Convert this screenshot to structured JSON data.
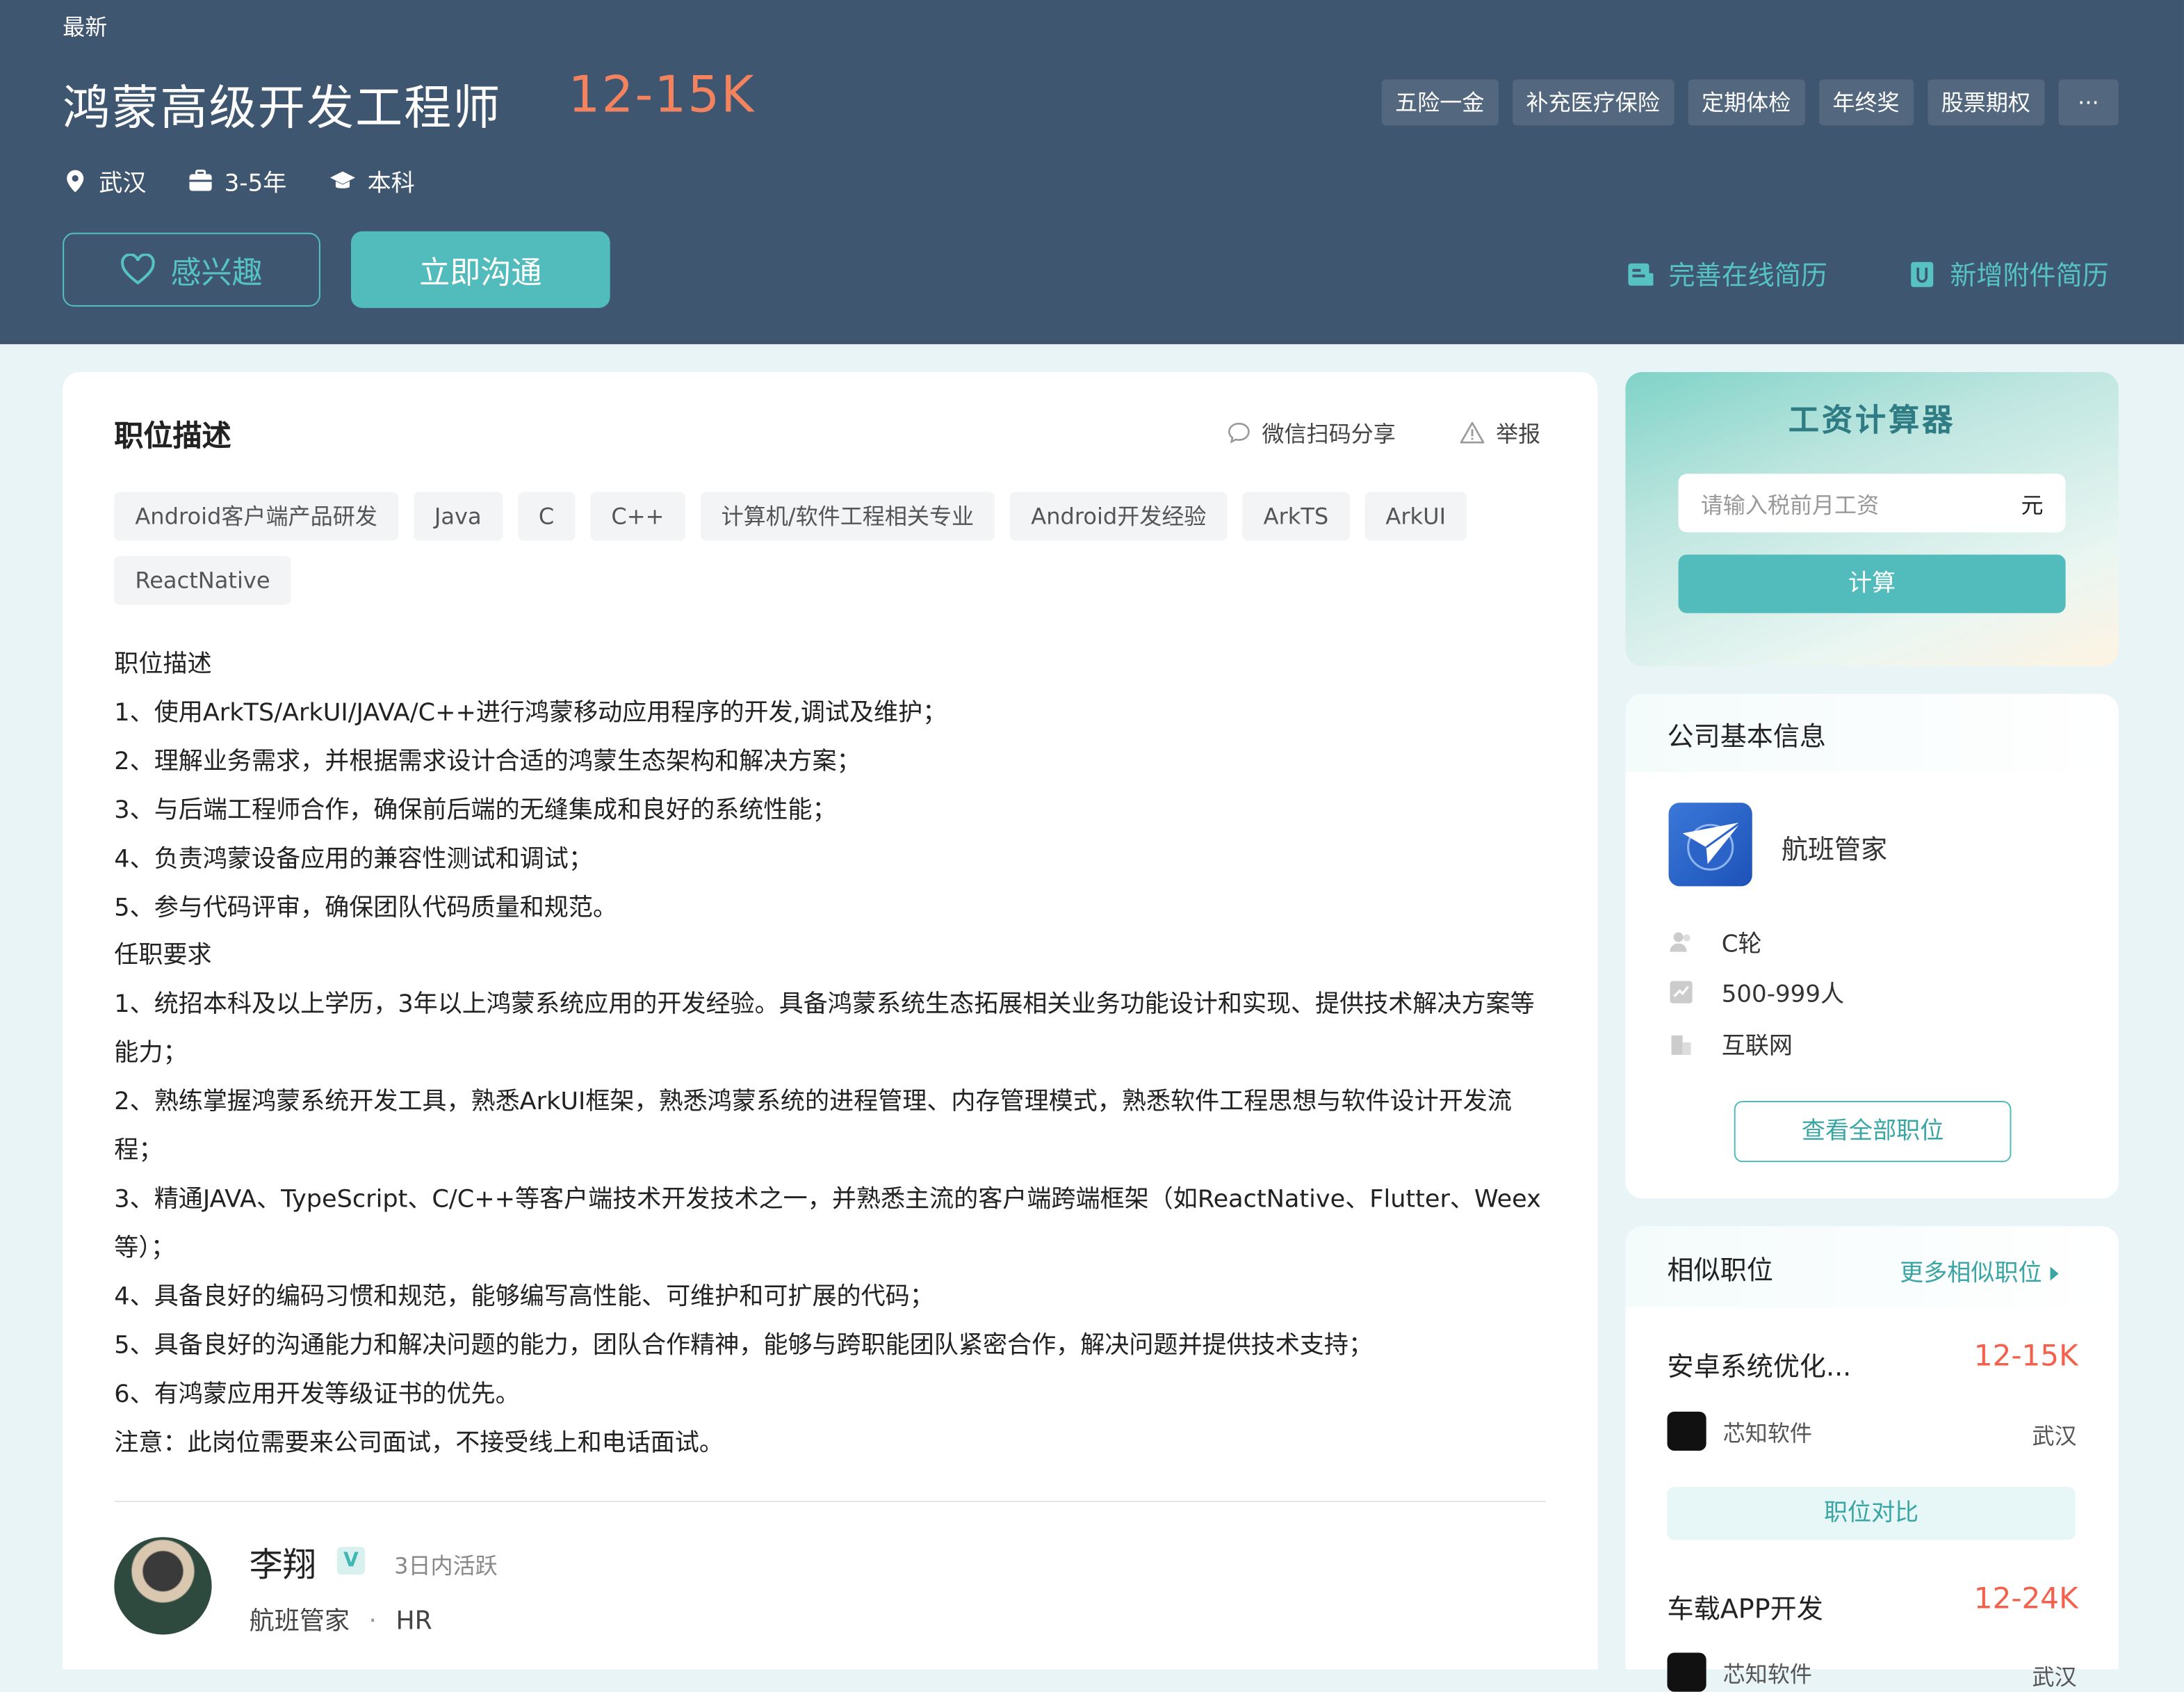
{
  "header": {
    "latest": "最新",
    "title": "鸿蒙高级开发工程师",
    "salary": "12-15K",
    "benefits": [
      "五险一金",
      "补充医疗保险",
      "定期体检",
      "年终奖",
      "股票期权",
      "···"
    ],
    "city": "武汉",
    "experience": "3-5年",
    "education": "本科",
    "interest_label": "感兴趣",
    "chat_label": "立即沟通",
    "improve_resume": "完善在线简历",
    "add_attachment": "新增附件简历"
  },
  "description": {
    "title": "职位描述",
    "share": "微信扫码分享",
    "report": "举报",
    "skills": [
      "Android客户端产品研发",
      "Java",
      "C",
      "C++",
      "计算机/软件工程相关专业",
      "Android开发经验",
      "ArkTS",
      "ArkUI",
      "ReactNative"
    ],
    "text": "职位描述\n1、使用ArkTS/ArkUI/JAVA/C++进行鸿蒙移动应用程序的开发,调试及维护；\n2、理解业务需求，并根据需求设计合适的鸿蒙生态架构和解决方案；\n3、与后端工程师合作，确保前后端的无缝集成和良好的系统性能；\n4、负责鸿蒙设备应用的兼容性测试和调试；\n5、参与代码评审，确保团队代码质量和规范。\n任职要求\n1、统招本科及以上学历，3年以上鸿蒙系统应用的开发经验。具备鸿蒙系统生态拓展相关业务功能设计和实现、提供技术解决方案等能力；\n2、熟练掌握鸿蒙系统开发工具，熟悉ArkUI框架，熟悉鸿蒙系统的进程管理、内存管理模式，熟悉软件工程思想与软件设计开发流程；\n3、精通JAVA、TypeScript、C/C++等客户端技术开发技术之一，并熟悉主流的客户端跨端框架（如ReactNative、Flutter、Weex等）；\n4、具备良好的编码习惯和规范，能够编写高性能、可维护和可扩展的代码；\n5、具备良好的沟通能力和解决问题的能力，团队合作精神，能够与跨职能团队紧密合作，解决问题并提供技术支持；\n6、有鸿蒙应用开发等级证书的优先。\n注意：此岗位需要来公司面试，不接受线上和电话面试。"
  },
  "recruiter": {
    "name": "李翔",
    "verified": "V",
    "active": "3日内活跃",
    "company": "航班管家",
    "separator": "·",
    "role": "HR"
  },
  "calculator": {
    "title": "工资计算器",
    "placeholder": "请输入税前月工资",
    "unit": "元",
    "button": "计算"
  },
  "company": {
    "section_title": "公司基本信息",
    "name": "航班管家",
    "stage": "C轮",
    "size": "500-999人",
    "industry": "互联网",
    "all_jobs": "查看全部职位"
  },
  "similar": {
    "title": "相似职位",
    "more": "更多相似职位",
    "compare": "职位对比",
    "jobs": [
      {
        "title": "安卓系统优化...",
        "salary": "12-15K",
        "company": "芯知软件",
        "city": "武汉"
      },
      {
        "title": "车载APP开发",
        "salary": "12-24K",
        "company": "芯知软件",
        "city": "武汉"
      }
    ]
  }
}
